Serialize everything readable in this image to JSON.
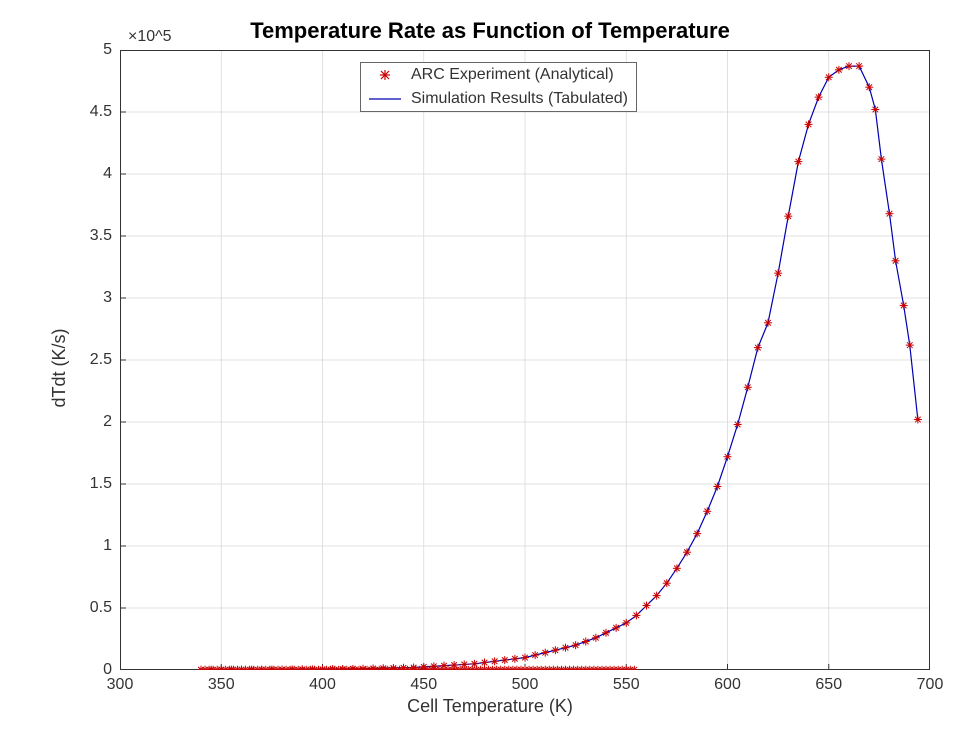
{
  "chart_data": {
    "type": "line",
    "title": "Temperature Rate as Function of Temperature",
    "xlabel": "Cell Temperature (K)",
    "ylabel": "dTdt (K/s)",
    "xlim": [
      300,
      700
    ],
    "ylim": [
      0,
      500000
    ],
    "y_exponent_label": "×10^5",
    "x_ticks": [
      300,
      350,
      400,
      450,
      500,
      550,
      600,
      650,
      700
    ],
    "y_ticks": [
      0,
      50000,
      100000,
      150000,
      200000,
      250000,
      300000,
      350000,
      400000,
      450000,
      500000
    ],
    "y_tick_labels": [
      "0",
      "0.5",
      "1",
      "1.5",
      "2",
      "2.5",
      "3",
      "3.5",
      "4",
      "4.5",
      "5"
    ],
    "legend": {
      "position": "top-center",
      "entries": [
        {
          "name": "ARC Experiment (Analytical)",
          "marker": "asterisk",
          "color": "#c80000"
        },
        {
          "name": "Simulation Results (Tabulated)",
          "marker": "line",
          "color": "#0000b0"
        }
      ]
    },
    "series": [
      {
        "name": "ARC Experiment (Analytical)",
        "style": "asterisk",
        "color": "#c80000",
        "x": [
          340,
          345,
          350,
          355,
          360,
          365,
          370,
          375,
          380,
          385,
          390,
          395,
          400,
          405,
          410,
          415,
          420,
          425,
          430,
          435,
          440,
          445,
          450,
          455,
          460,
          465,
          470,
          475,
          480,
          485,
          490,
          495,
          500,
          505,
          510,
          515,
          520,
          525,
          530,
          535,
          540,
          545,
          550,
          555,
          560,
          565,
          570,
          575,
          580,
          585,
          590,
          595,
          600,
          605,
          610,
          615,
          620,
          625,
          630,
          635,
          640,
          645,
          650,
          655,
          660,
          665,
          670,
          673,
          676,
          680,
          683,
          687,
          690,
          694
        ],
        "y": [
          200,
          200,
          250,
          250,
          300,
          300,
          350,
          350,
          400,
          400,
          500,
          500,
          600,
          700,
          800,
          900,
          1000,
          1200,
          1400,
          1600,
          1800,
          2000,
          2500,
          3000,
          3500,
          4000,
          4500,
          5000,
          6000,
          7000,
          8000,
          9000,
          10000,
          12000,
          14000,
          16000,
          18000,
          20000,
          23000,
          26000,
          30000,
          34000,
          38000,
          44000,
          52000,
          60000,
          70000,
          82000,
          95000,
          110000,
          128000,
          148000,
          172000,
          198000,
          228000,
          260000,
          280000,
          320000,
          366000,
          410000,
          440000,
          462000,
          478000,
          484000,
          487000,
          487000,
          470000,
          452000,
          412000,
          368000,
          330000,
          294000,
          262000,
          202000
        ]
      },
      {
        "name": "Simulation Results (Tabulated)",
        "style": "line",
        "color": "#0000b0",
        "x": [
          340,
          345,
          350,
          355,
          360,
          365,
          370,
          375,
          380,
          385,
          390,
          395,
          400,
          405,
          410,
          415,
          420,
          425,
          430,
          435,
          440,
          445,
          450,
          455,
          460,
          465,
          470,
          475,
          480,
          485,
          490,
          495,
          500,
          505,
          510,
          515,
          520,
          525,
          530,
          535,
          540,
          545,
          550,
          555,
          560,
          565,
          570,
          575,
          580,
          585,
          590,
          595,
          600,
          605,
          610,
          615,
          620,
          625,
          630,
          635,
          640,
          645,
          650,
          655,
          660,
          665,
          670,
          673,
          676,
          680,
          683,
          687,
          690,
          694
        ],
        "y": [
          200,
          200,
          250,
          250,
          300,
          300,
          350,
          350,
          400,
          400,
          500,
          500,
          600,
          700,
          800,
          900,
          1000,
          1200,
          1400,
          1600,
          1800,
          2000,
          2500,
          3000,
          3500,
          4000,
          4500,
          5000,
          6000,
          7000,
          8000,
          9000,
          10000,
          12000,
          14000,
          16000,
          18000,
          20000,
          23000,
          26000,
          30000,
          34000,
          38000,
          44000,
          52000,
          60000,
          70000,
          82000,
          95000,
          110000,
          128000,
          148000,
          172000,
          198000,
          228000,
          260000,
          280000,
          320000,
          366000,
          410000,
          440000,
          462000,
          478000,
          484000,
          487000,
          487000,
          470000,
          452000,
          412000,
          368000,
          330000,
          294000,
          262000,
          202000
        ]
      }
    ]
  }
}
